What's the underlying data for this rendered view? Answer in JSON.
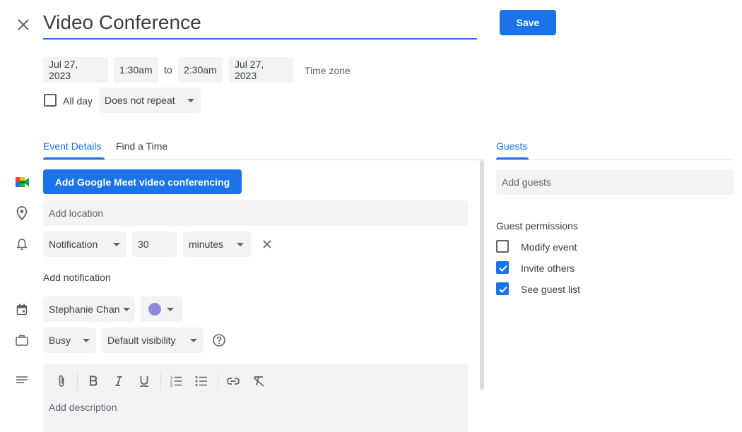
{
  "header": {
    "close_icon": "close-icon",
    "title": "Video Conference",
    "save_label": "Save"
  },
  "datetime": {
    "start_date": "Jul 27, 2023",
    "start_time": "1:30am",
    "to_label": "to",
    "end_time": "2:30am",
    "end_date": "Jul 27, 2023",
    "timezone_label": "Time zone"
  },
  "all_day": {
    "label": "All day",
    "checked": false
  },
  "repeat": {
    "value": "Does not repeat"
  },
  "tabs": [
    {
      "label": "Event Details",
      "active": true
    },
    {
      "label": "Find a Time",
      "active": false
    }
  ],
  "details": {
    "meet_button": "Add Google Meet video conferencing",
    "location_placeholder": "Add location",
    "notification": {
      "type": "Notification",
      "value": "30",
      "unit": "minutes"
    },
    "add_notification": "Add notification",
    "calendar_owner": "Stephanie Chan",
    "calendar_color": "#8e8cd8",
    "availability": "Busy",
    "visibility": "Default visibility",
    "description_placeholder": "Add description"
  },
  "guests": {
    "tab_label": "Guests",
    "add_placeholder": "Add guests",
    "permissions_title": "Guest permissions",
    "permissions": [
      {
        "label": "Modify event",
        "checked": false
      },
      {
        "label": "Invite others",
        "checked": true
      },
      {
        "label": "See guest list",
        "checked": true
      }
    ]
  },
  "colors": {
    "accent": "#1a73e8",
    "chip_bg": "#f1f3f4",
    "text": "#3c4043"
  }
}
